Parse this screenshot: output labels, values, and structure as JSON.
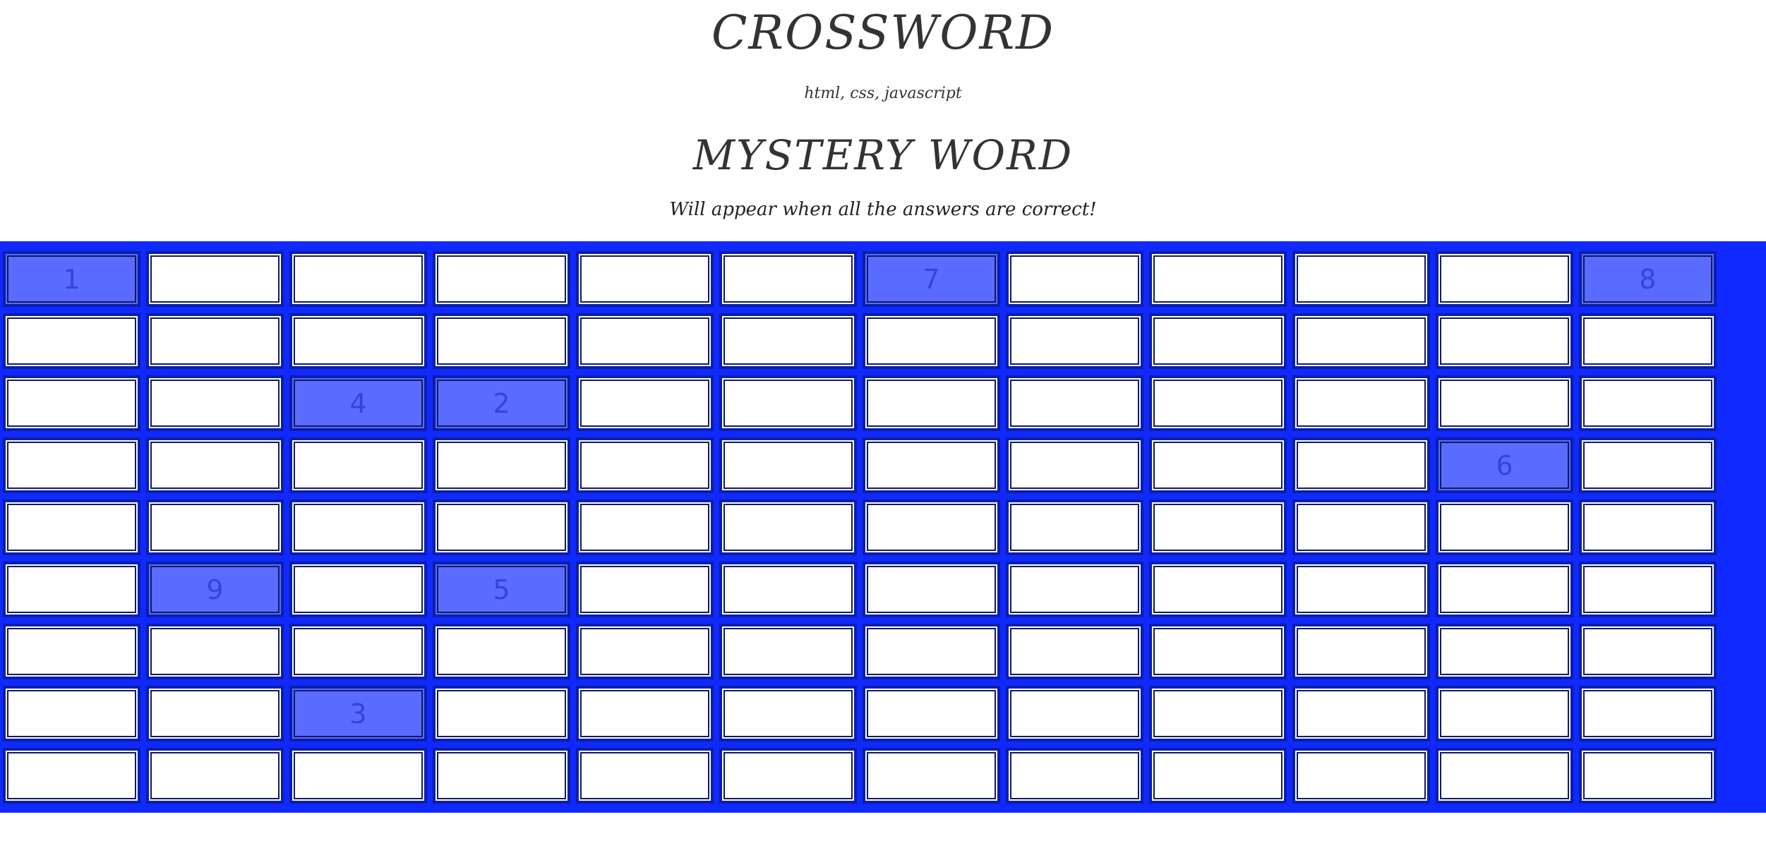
{
  "header": {
    "title": "CROSSWORD",
    "subtitle": "html, css, javascript",
    "mystery_title": "MYSTERY WORD",
    "mystery_note": "Will appear when all the answers are correct!"
  },
  "colors": {
    "board": "#1029ff",
    "cell": "#ffffff",
    "numbered_cell": "#5a6cff",
    "cell_border": "#0a1fa8"
  },
  "grid": {
    "rows": 9,
    "cols": 12,
    "numbered_cells": [
      {
        "row": 0,
        "col": 0,
        "number": "1"
      },
      {
        "row": 0,
        "col": 6,
        "number": "7"
      },
      {
        "row": 0,
        "col": 11,
        "number": "8"
      },
      {
        "row": 2,
        "col": 2,
        "number": "4"
      },
      {
        "row": 2,
        "col": 3,
        "number": "2"
      },
      {
        "row": 3,
        "col": 10,
        "number": "6"
      },
      {
        "row": 5,
        "col": 1,
        "number": "9"
      },
      {
        "row": 5,
        "col": 3,
        "number": "5"
      },
      {
        "row": 7,
        "col": 2,
        "number": "3"
      }
    ]
  }
}
